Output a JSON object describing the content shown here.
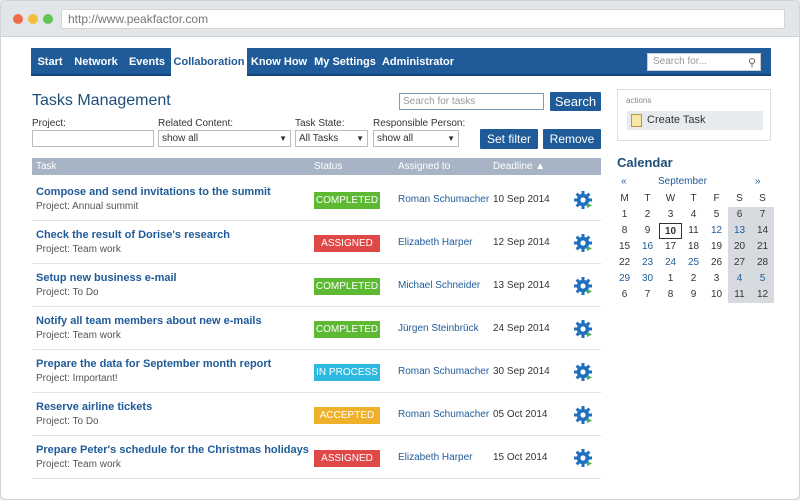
{
  "browser": {
    "url": "http://www.peakfactor.com"
  },
  "nav": {
    "items": [
      "Start",
      "Network",
      "Events",
      "Collaboration",
      "Know How",
      "My Settings",
      "Administrator"
    ],
    "active": "Collaboration",
    "search_placeholder": "Search for..."
  },
  "page": {
    "title": "Tasks Management",
    "search_placeholder": "Search for tasks",
    "search_button": "Search"
  },
  "filters": {
    "project_label": "Project:",
    "project_value": "",
    "related_label": "Related Content:",
    "related_value": "show all",
    "state_label": "Task State:",
    "state_value": "All Tasks",
    "person_label": "Responsible Person:",
    "person_value": "show all",
    "set_filter": "Set filter",
    "remove": "Remove"
  },
  "table": {
    "headers": {
      "task": "Task",
      "status": "Status",
      "assigned": "Assigned to",
      "deadline": "Deadline ▲"
    },
    "rows": [
      {
        "title": "Compose and send invitations to the summit",
        "project": "Project: Annual summit",
        "status": "COMPLETED",
        "assigned": "Roman Schumacher",
        "deadline": "10 Sep 2014"
      },
      {
        "title": "Check the result of Dorise's research",
        "project": "Project: Team work",
        "status": "ASSIGNED",
        "assigned": "Elizabeth Harper",
        "deadline": "12 Sep 2014"
      },
      {
        "title": "Setup new business e-mail",
        "project": "Project: To Do",
        "status": "COMPLETED",
        "assigned": "Michael Schneider",
        "deadline": "13 Sep 2014"
      },
      {
        "title": "Notify all team members about new e-mails",
        "project": "Project: Team work",
        "status": "COMPLETED",
        "assigned": "Jürgen Steinbrück",
        "deadline": "24 Sep 2014"
      },
      {
        "title": "Prepare the data for September month report",
        "project": "Project: Important!",
        "status": "IN PROCESS",
        "assigned": "Roman Schumacher",
        "deadline": "30 Sep 2014"
      },
      {
        "title": "Reserve airline tickets",
        "project": "Project: To Do",
        "status": "ACCEPTED",
        "assigned": "Roman Schumacher",
        "deadline": "05 Oct 2014"
      },
      {
        "title": "Prepare Peter's schedule for the Christmas holidays",
        "project": "Project: Team work",
        "status": "ASSIGNED",
        "assigned": "Elizabeth Harper",
        "deadline": "15 Oct 2014"
      }
    ]
  },
  "status_colors": {
    "COMPLETED": "#5cb931",
    "ASSIGNED": "#e04848",
    "IN PROCESS": "#2db9e0",
    "ACCEPTED": "#f0b12a"
  },
  "sidebar": {
    "actions_label": "actions",
    "create_task": "Create Task",
    "calendar_title": "Calendar",
    "calendar": {
      "prev": "«",
      "month": "September",
      "next": "»",
      "weekdays": [
        "M",
        "T",
        "W",
        "T",
        "F",
        "S",
        "S"
      ],
      "weeks": [
        [
          "1",
          "2",
          "3",
          "4",
          "5",
          "6",
          "7"
        ],
        [
          "8",
          "9",
          "10",
          "11",
          "12",
          "13",
          "14"
        ],
        [
          "15",
          "16",
          "17",
          "18",
          "19",
          "20",
          "21"
        ],
        [
          "22",
          "23",
          "24",
          "25",
          "26",
          "27",
          "28"
        ],
        [
          "29",
          "30",
          "1",
          "2",
          "3",
          "4",
          "5"
        ],
        [
          "6",
          "7",
          "8",
          "9",
          "10",
          "11",
          "12"
        ]
      ],
      "today": "10",
      "highlighted_dates": [
        "12",
        "13",
        "16",
        "23",
        "24",
        "25",
        "29",
        "30",
        "4",
        "5"
      ]
    }
  }
}
